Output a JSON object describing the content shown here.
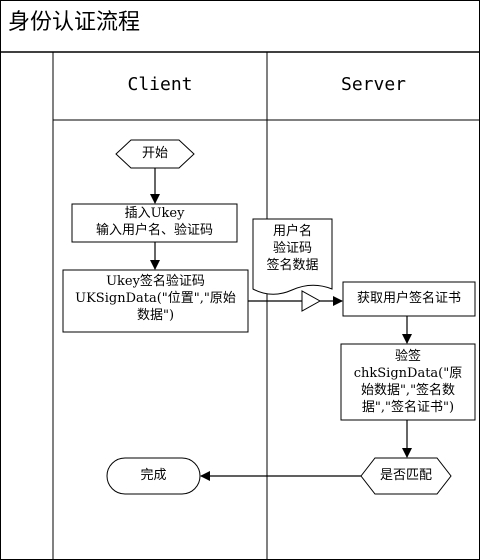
{
  "title": "身份认证流程",
  "lanes": {
    "client": "Client",
    "server": "Server"
  },
  "nodes": {
    "start": "开始",
    "insert_line1": "插入Ukey",
    "insert_line2": "输入用户名、验证码",
    "sign_line1": "Ukey签名验证码",
    "sign_line2": "UKSignData(\"位置\",\"原始",
    "sign_line3": "数据\")",
    "doc_line1": "用户名",
    "doc_line2": "验证码",
    "doc_line3": "签名数据",
    "getcert": "获取用户签名证书",
    "verify_line1": "验签",
    "verify_line2": "chkSignData(\"原",
    "verify_line3": "始数据\",\"签名数",
    "verify_line4": "据\",\"签名证书\")",
    "match": "是否匹配",
    "done": "完成"
  }
}
